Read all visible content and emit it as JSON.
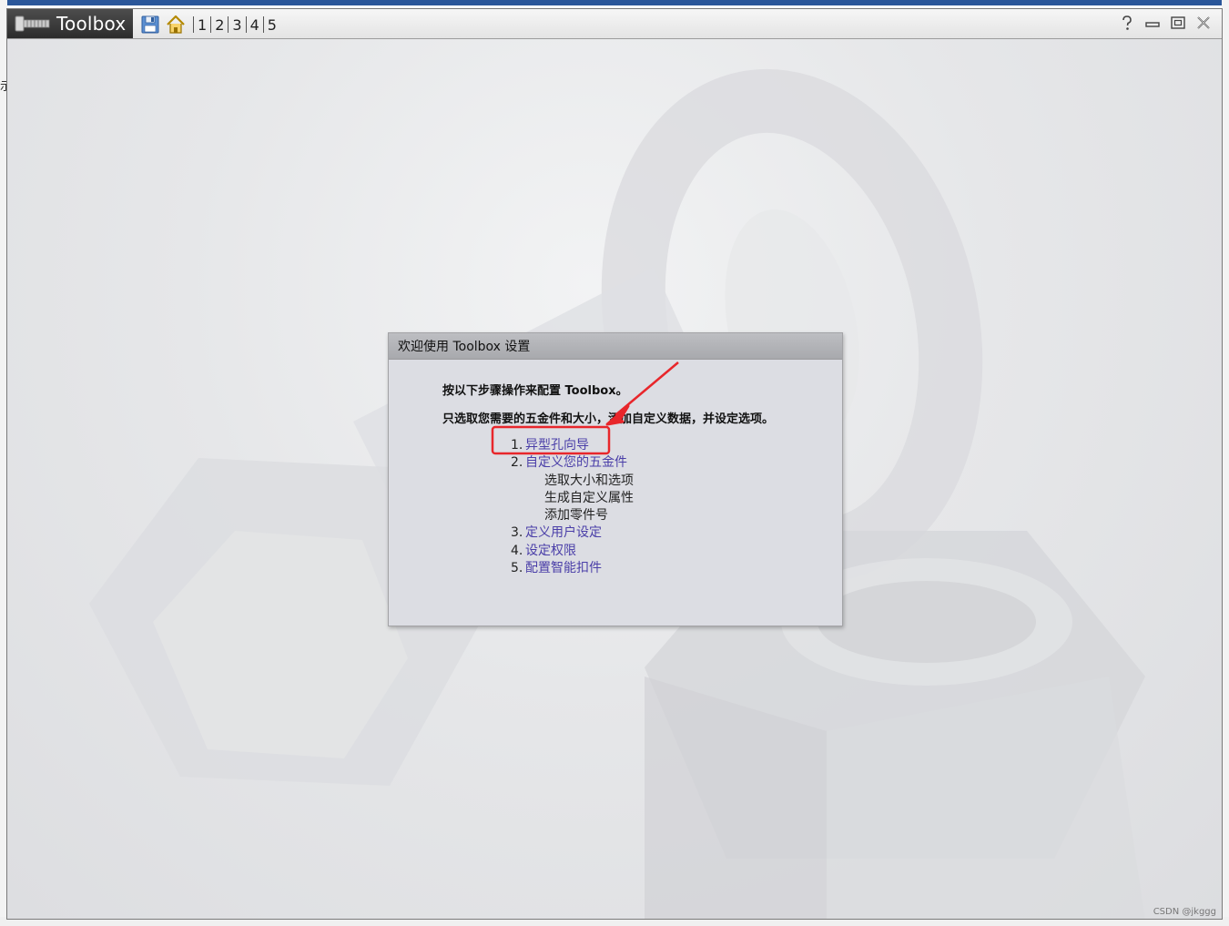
{
  "window": {
    "title": "Toolbox",
    "step_links": [
      "1",
      "2",
      "3",
      "4",
      "5"
    ]
  },
  "icons": {
    "bolt": "bolt-icon",
    "save": "save-icon",
    "home": "home-icon",
    "help": "help-icon",
    "minimize": "minimize-icon",
    "restore": "restore-icon",
    "close": "close-icon"
  },
  "dialog": {
    "title": "欢迎使用 Toolbox 设置",
    "intro_line1": "按以下步骤操作来配置 Toolbox。",
    "intro_line2": "只选取您需要的五金件和大小，添加自定义数据，并设定选项。",
    "steps": [
      {
        "num": "1.",
        "label": "异型孔向导",
        "subitems": []
      },
      {
        "num": "2.",
        "label": "自定义您的五金件",
        "subitems": [
          "选取大小和选项",
          "生成自定义属性",
          "添加零件号"
        ]
      },
      {
        "num": "3.",
        "label": "定义用户设定",
        "subitems": []
      },
      {
        "num": "4.",
        "label": "设定权限",
        "subitems": []
      },
      {
        "num": "5.",
        "label": "配置智能扣件",
        "subitems": []
      }
    ]
  },
  "background_app": {
    "left_mark": "示"
  },
  "watermark": "CSDN @jkggg",
  "colors": {
    "link": "#4a3ea8",
    "annotation": "#e8262b",
    "titlebar_tab": "#3a3a3a"
  }
}
